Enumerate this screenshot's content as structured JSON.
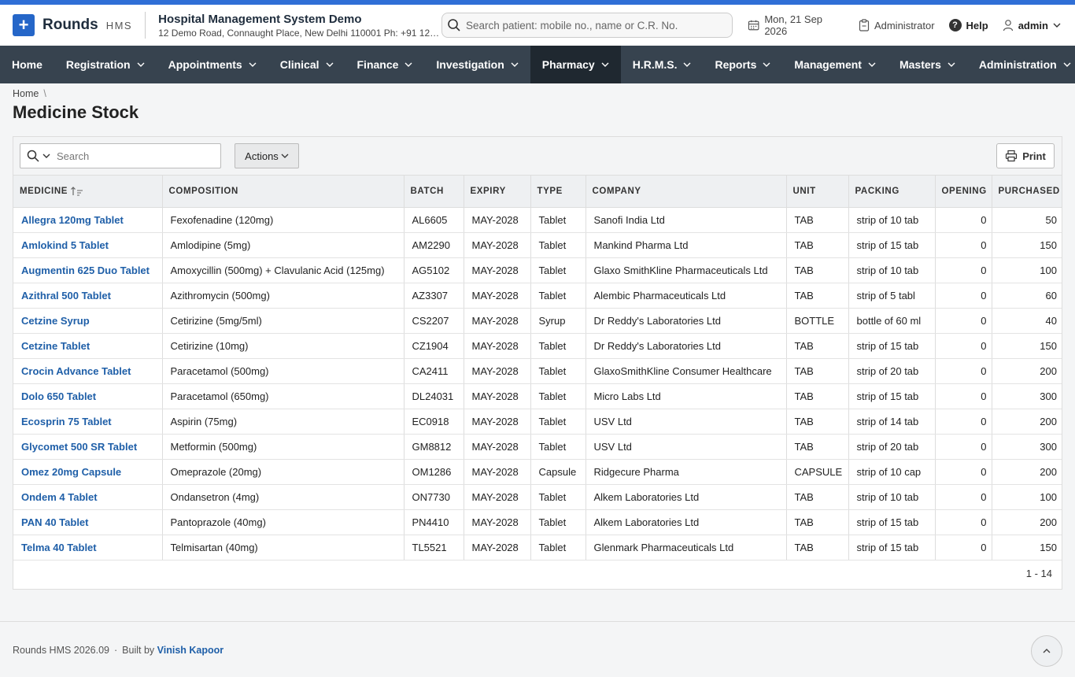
{
  "header": {
    "brand": "Rounds",
    "brand_sub": "HMS",
    "hospital_name": "Hospital Management System Demo",
    "hospital_address": "12 Demo Road, Connaught Place, New Delhi 110001 Ph: +91 123...",
    "search_placeholder": "Search patient: mobile no., name or C.R. No.",
    "date": "Mon, 21 Sep 2026",
    "role": "Administrator",
    "help": "Help",
    "user": "admin"
  },
  "nav": {
    "items": [
      {
        "label": "Home"
      },
      {
        "label": "Registration"
      },
      {
        "label": "Appointments"
      },
      {
        "label": "Clinical"
      },
      {
        "label": "Finance"
      },
      {
        "label": "Investigation"
      },
      {
        "label": "Pharmacy"
      },
      {
        "label": "H.R.M.S."
      },
      {
        "label": "Reports"
      },
      {
        "label": "Management"
      },
      {
        "label": "Masters"
      },
      {
        "label": "Administration"
      }
    ],
    "active": "Pharmacy"
  },
  "breadcrumb": {
    "home": "Home",
    "sep": "\\"
  },
  "page": {
    "title": "Medicine Stock"
  },
  "toolbar": {
    "search_placeholder": "Search",
    "actions_label": "Actions",
    "print_label": "Print"
  },
  "table": {
    "columns": [
      "MEDICINE",
      "COMPOSITION",
      "BATCH",
      "EXPIRY",
      "TYPE",
      "COMPANY",
      "UNIT",
      "PACKING",
      "OPENING",
      "PURCHASED"
    ],
    "rows": [
      [
        "Allegra 120mg Tablet",
        "Fexofenadine (120mg)",
        "AL6605",
        "MAY-2028",
        "Tablet",
        "Sanofi India Ltd",
        "TAB",
        "strip of 10 tab",
        "0",
        "50"
      ],
      [
        "Amlokind 5 Tablet",
        "Amlodipine (5mg)",
        "AM2290",
        "MAY-2028",
        "Tablet",
        "Mankind Pharma Ltd",
        "TAB",
        "strip of 15 tab",
        "0",
        "150"
      ],
      [
        "Augmentin 625 Duo Tablet",
        "Amoxycillin (500mg) + Clavulanic Acid (125mg)",
        "AG5102",
        "MAY-2028",
        "Tablet",
        "Glaxo SmithKline Pharmaceuticals Ltd",
        "TAB",
        "strip of 10 tab",
        "0",
        "100"
      ],
      [
        "Azithral 500 Tablet",
        "Azithromycin (500mg)",
        "AZ3307",
        "MAY-2028",
        "Tablet",
        "Alembic Pharmaceuticals Ltd",
        "TAB",
        "strip of 5 tabl",
        "0",
        "60"
      ],
      [
        "Cetzine Syrup",
        "Cetirizine (5mg/5ml)",
        "CS2207",
        "MAY-2028",
        "Syrup",
        "Dr Reddy's Laboratories Ltd",
        "BOTTLE",
        "bottle of 60 ml",
        "0",
        "40"
      ],
      [
        "Cetzine Tablet",
        "Cetirizine (10mg)",
        "CZ1904",
        "MAY-2028",
        "Tablet",
        "Dr Reddy's Laboratories Ltd",
        "TAB",
        "strip of 15 tab",
        "0",
        "150"
      ],
      [
        "Crocin Advance Tablet",
        "Paracetamol (500mg)",
        "CA2411",
        "MAY-2028",
        "Tablet",
        "GlaxoSmithKline Consumer Healthcare",
        "TAB",
        "strip of 20 tab",
        "0",
        "200"
      ],
      [
        "Dolo 650 Tablet",
        "Paracetamol (650mg)",
        "DL24031",
        "MAY-2028",
        "Tablet",
        "Micro Labs Ltd",
        "TAB",
        "strip of 15 tab",
        "0",
        "300"
      ],
      [
        "Ecosprin 75 Tablet",
        "Aspirin (75mg)",
        "EC0918",
        "MAY-2028",
        "Tablet",
        "USV Ltd",
        "TAB",
        "strip of 14 tab",
        "0",
        "200"
      ],
      [
        "Glycomet 500 SR Tablet",
        "Metformin (500mg)",
        "GM8812",
        "MAY-2028",
        "Tablet",
        "USV Ltd",
        "TAB",
        "strip of 20 tab",
        "0",
        "300"
      ],
      [
        "Omez 20mg Capsule",
        "Omeprazole (20mg)",
        "OM1286",
        "MAY-2028",
        "Capsule",
        "Ridgecure Pharma",
        "CAPSULE",
        "strip of 10 cap",
        "0",
        "200"
      ],
      [
        "Ondem 4 Tablet",
        "Ondansetron (4mg)",
        "ON7730",
        "MAY-2028",
        "Tablet",
        "Alkem Laboratories Ltd",
        "TAB",
        "strip of 10 tab",
        "0",
        "100"
      ],
      [
        "PAN 40 Tablet",
        "Pantoprazole (40mg)",
        "PN4410",
        "MAY-2028",
        "Tablet",
        "Alkem Laboratories Ltd",
        "TAB",
        "strip of 15 tab",
        "0",
        "200"
      ],
      [
        "Telma 40 Tablet",
        "Telmisartan (40mg)",
        "TL5521",
        "MAY-2028",
        "Tablet",
        "Glenmark Pharmaceuticals Ltd",
        "TAB",
        "strip of 15 tab",
        "0",
        "150"
      ]
    ],
    "record_count": "1 - 14"
  },
  "footer": {
    "version": "Rounds HMS 2026.09",
    "dot": "·",
    "built_by": "Built by",
    "author": "Vinish Kapoor"
  },
  "colors": {
    "accent": "#2566c8",
    "navbar": "#37434f",
    "nav_active": "#1f2830",
    "link": "#1f5fa8"
  }
}
